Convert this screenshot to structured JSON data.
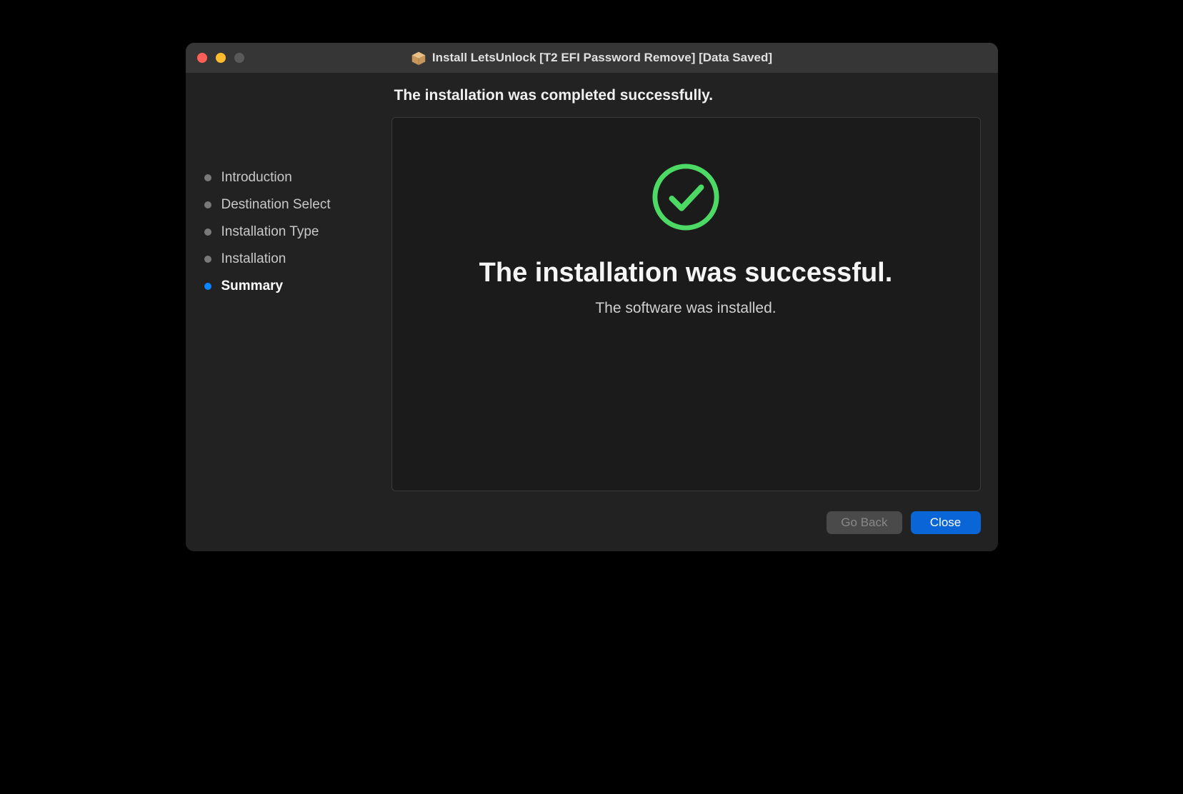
{
  "window": {
    "title": "Install LetsUnlock [T2 EFI Password Remove] [Data Saved]"
  },
  "sidebar": {
    "items": [
      {
        "label": "Introduction",
        "active": false
      },
      {
        "label": "Destination Select",
        "active": false
      },
      {
        "label": "Installation Type",
        "active": false
      },
      {
        "label": "Installation",
        "active": false
      },
      {
        "label": "Summary",
        "active": true
      }
    ]
  },
  "main": {
    "status_heading": "The installation was completed successfully.",
    "success_title": "The installation was successful.",
    "success_subtitle": "The software was installed."
  },
  "footer": {
    "go_back_label": "Go Back",
    "close_label": "Close"
  },
  "colors": {
    "accent": "#0a84ff",
    "success": "#4cd964"
  }
}
